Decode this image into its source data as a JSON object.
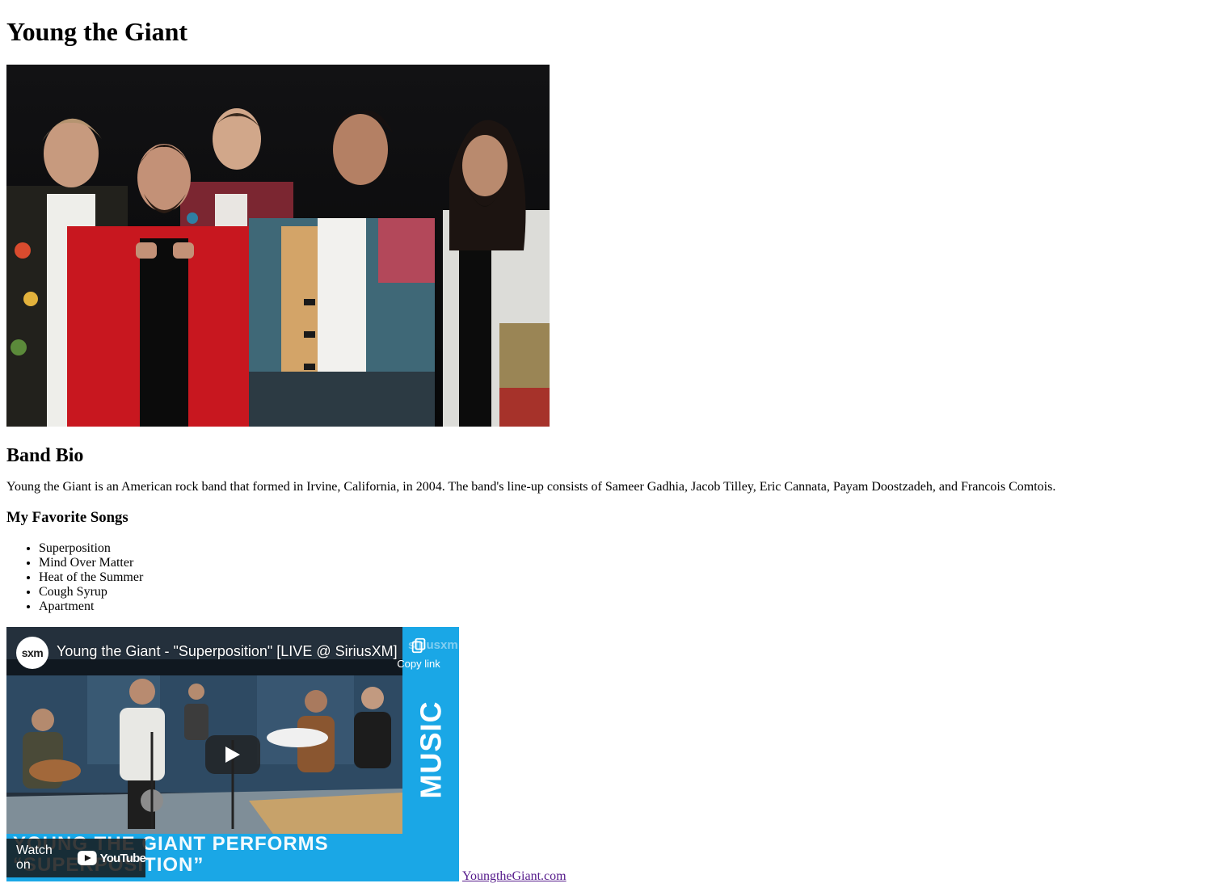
{
  "page": {
    "title": "Young the Giant"
  },
  "bio": {
    "heading": "Band Bio",
    "text": "Young the Giant is an American rock band that formed in Irvine, California, in 2004. The band's line-up consists of Sameer Gadhia, Jacob Tilley, Eric Cannata, Payam Doostzadeh, and Francois Comtois."
  },
  "songs": {
    "heading": "My Favorite Songs",
    "items": [
      "Superposition",
      "Mind Over Matter",
      "Heat of the Summer",
      "Cough Syrup",
      "Apartment"
    ]
  },
  "video": {
    "channel_logo": "sxm",
    "title": "Young the Giant - \"Superposition\" [LIVE @ SiriusXM]",
    "copy_link_label": "Copy link",
    "watch_on_label": "Watch on",
    "youtube_label": "YouTube",
    "side_brand": "siriusxm",
    "side_banner_text": "MUSIC",
    "lower_banner_line1": "YOUNG THE GIANT PERFORMS",
    "lower_banner_line2": "“SUPERPOSITION”",
    "banner_color": "#1aa7e6"
  },
  "link": {
    "text": "YoungtheGiant.com",
    "color": "#551a8b"
  }
}
